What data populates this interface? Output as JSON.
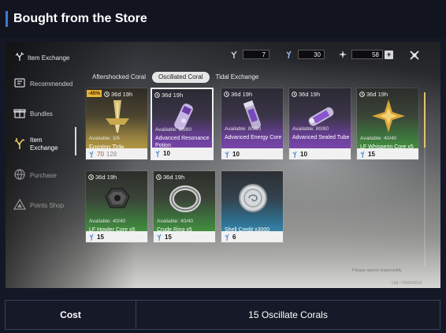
{
  "page": {
    "title": "Bought from the Store"
  },
  "game": {
    "screen_title": "Item Exchange",
    "currencies": [
      {
        "icon": "aftershocked-coral-icon",
        "value": "7"
      },
      {
        "icon": "oscillated-coral-icon",
        "value": "30"
      },
      {
        "icon": "lustrous-tide-icon",
        "value": "58"
      }
    ],
    "sidebar": [
      {
        "label": "Recommended",
        "icon": "recommended-icon"
      },
      {
        "label": "Bundles",
        "icon": "gift-icon"
      },
      {
        "label": "Item\nExchange",
        "icon": "coral-icon"
      },
      {
        "label": "Purchase",
        "icon": "globe-icon"
      },
      {
        "label": "Points Shop",
        "icon": "triangle-icon"
      }
    ],
    "tabs": [
      "Aftershocked Coral",
      "Oscillated Coral",
      "Tidal Exchange"
    ],
    "active_tab": "Oscillated Coral",
    "cards": [
      {
        "timer": "36d 19h",
        "discount": "-45%",
        "available": "Available: 3/6",
        "name": "Forging Tide",
        "price": "70",
        "old_price": "128",
        "rarity": "gold",
        "icon": "forging-tide-icon"
      },
      {
        "timer": "36d 19h",
        "available": "Available: 80/80",
        "name": "Advanced Resonance Potion",
        "price": "10",
        "rarity": "purple",
        "icon": "resonance-potion-icon"
      },
      {
        "timer": "36d 19h",
        "available": "Available: 80/80",
        "name": "Advanced Energy Core",
        "price": "10",
        "rarity": "purple",
        "icon": "energy-core-icon"
      },
      {
        "timer": "36d 19h",
        "available": "Available: 80/80",
        "name": "Advanced Sealed Tube",
        "price": "10",
        "rarity": "purple",
        "icon": "sealed-tube-icon"
      },
      {
        "timer": "36d 19h",
        "available": "Available: 40/40",
        "name": "LF Whisperin Core x5",
        "price": "15",
        "rarity": "green",
        "icon": "whisperin-core-icon"
      },
      {
        "timer": "36d 19h",
        "available": "Available: 40/40",
        "name": "LF Howler Core x5",
        "price": "15",
        "rarity": "green",
        "icon": "howler-core-icon"
      },
      {
        "timer": "36d 19h",
        "available": "Available: 40/40",
        "name": "Crude Ring x5",
        "price": "15",
        "rarity": "green",
        "icon": "crude-ring-icon"
      },
      {
        "timer": "",
        "available": "",
        "name": "Shell Credit x3000",
        "price": "6",
        "rarity": "blue",
        "icon": "shell-credit-icon"
      }
    ],
    "footer_note": "Please spend responsibly",
    "uid_note": "Uid: 700000815"
  },
  "cost_table": {
    "label": "Cost",
    "value": "15 Oscillate Corals"
  }
}
